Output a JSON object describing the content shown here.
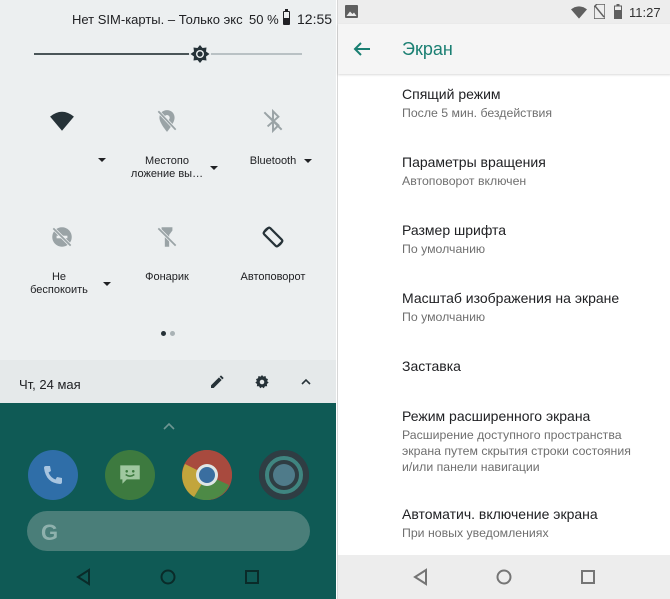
{
  "left_panel": {
    "status": {
      "carrier": "Нет SIM-карты. – Только экс",
      "battery_percent": "50 %",
      "time": "12:55"
    },
    "brightness": {
      "level": 0.62
    },
    "tiles": [
      {
        "label": "",
        "icon": "wifi-icon"
      },
      {
        "label": "Местоположение вы…",
        "line1": "Местопо",
        "line2": "ложение вы…",
        "icon": "location-off-icon"
      },
      {
        "label": "Bluetooth",
        "icon": "bluetooth-off-icon"
      },
      {
        "label": "Не беспокоить",
        "line1": "Не",
        "line2": "беспокоить",
        "icon": "do-not-disturb-icon"
      },
      {
        "label": "Фонарик",
        "icon": "flashlight-off-icon"
      },
      {
        "label": "Автоповорот",
        "icon": "auto-rotate-icon"
      }
    ],
    "pager": {
      "pages": 2,
      "active": 0
    },
    "footer": {
      "date": "Чт, 24 мая",
      "icons": [
        "edit-icon",
        "gear-icon",
        "chevron-up-icon"
      ]
    },
    "home": {
      "apps": [
        "phone-icon",
        "messages-icon",
        "chrome-icon",
        "camera-icon"
      ],
      "search_letter": "G"
    }
  },
  "right_panel": {
    "status": {
      "time": "11:27"
    },
    "header": {
      "title": "Экран"
    },
    "items": [
      {
        "title": "Спящий режим",
        "subtitle": "После 5 мин. бездействия"
      },
      {
        "title": "Параметры вращения",
        "subtitle": "Автоповорот включен"
      },
      {
        "title": "Размер шрифта",
        "subtitle": "По умолчанию"
      },
      {
        "title": "Масштаб изображения на экране",
        "subtitle": "По умолчанию"
      },
      {
        "title": "Заставка",
        "subtitle": ""
      },
      {
        "title": "Режим расширенного экрана",
        "subtitle_lines": [
          "Расширение доступного пространства",
          "экрана путем скрытия строки состояния",
          "и/или панели навигации"
        ]
      },
      {
        "title": "Автоматич. включение экрана",
        "subtitle": "При новых уведомлениях"
      }
    ]
  },
  "colors": {
    "accent": "#1a7f72",
    "qs_background": "#eceff0",
    "home_background": "#0f5a55"
  }
}
